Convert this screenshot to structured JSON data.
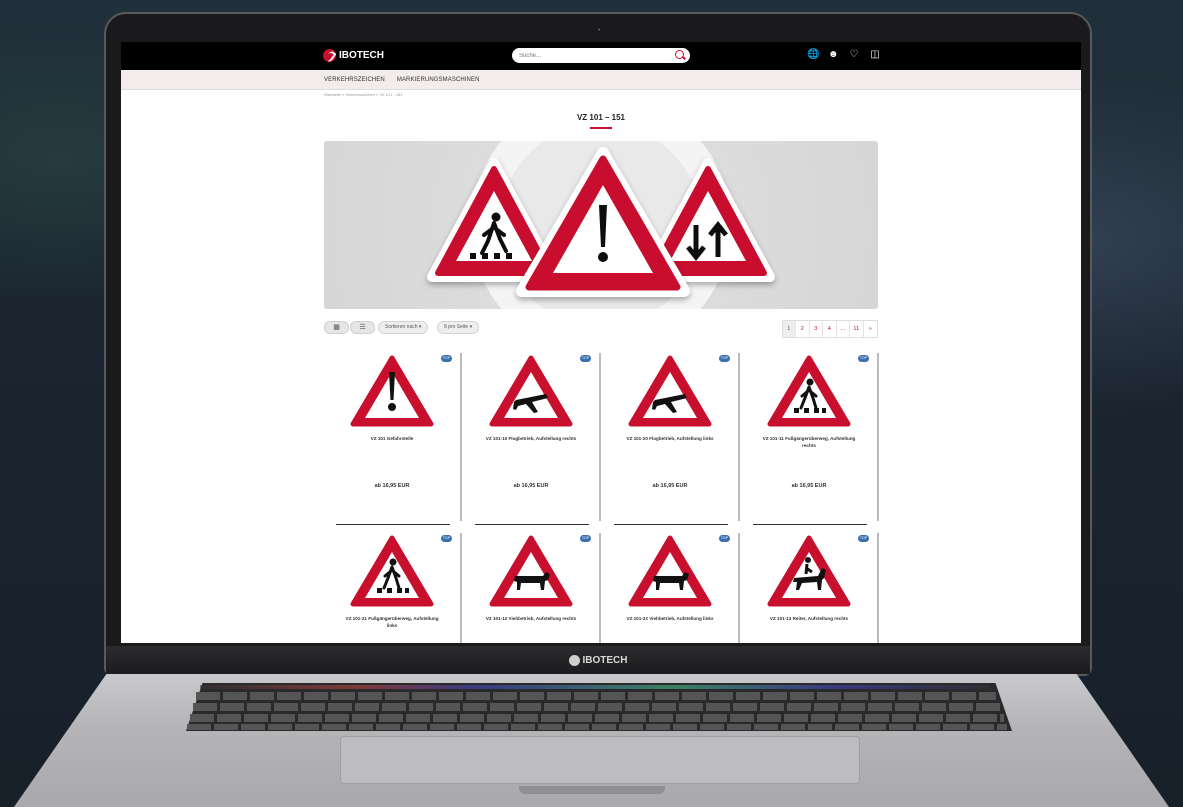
{
  "site": {
    "brand": "IBOTECH",
    "search_placeholder": "Suche...",
    "nav": [
      "VERKEHRSZEICHEN",
      "MARKIERUNGSMASCHINEN"
    ],
    "breadcrumb": "Startseite  »  Verkehrszeichen  »  VZ 101 - 151",
    "page_title": "VZ 101 – 151"
  },
  "toolbar": {
    "sort_label": "Sortieren nach",
    "per_page_label": "8 pro Seite",
    "pages": [
      "1",
      "2",
      "3",
      "4",
      "...",
      "11",
      "»"
    ],
    "current_page": "1"
  },
  "products": [
    {
      "name": "VZ 101 Gefahrstelle",
      "price": "ab 16,95 EUR",
      "symbol": "exclamation-mark"
    },
    {
      "name": "VZ 101-10 Flugbetrieb, Aufstellung rechts",
      "price": "ab 16,95 EUR",
      "symbol": "airplane"
    },
    {
      "name": "VZ 101-20 Flugbetrieb, Aufstellung links",
      "price": "ab 16,95 EUR",
      "symbol": "airplane"
    },
    {
      "name": "VZ 101-11 Fußgängerüberweg, Aufstellung rechts",
      "price": "ab 16,95 EUR",
      "symbol": "pedestrian"
    },
    {
      "name": "VZ 101-21 Fußgängerüberweg, Aufstellung links",
      "symbol": "pedestrian"
    },
    {
      "name": "VZ 101-12 Viehbetrieb, Aufstellung rechts",
      "symbol": "cow"
    },
    {
      "name": "VZ 101-22 Viehbetrieb, Aufstellung links",
      "symbol": "cow"
    },
    {
      "name": "VZ 101-13 Reiter, Aufstellung rechts",
      "symbol": "horse-rider"
    }
  ],
  "badge_text": "TOP",
  "chin_brand": "IBOTECH",
  "colors": {
    "accent": "#c8102e",
    "badge": "#3a6fb0",
    "topbar": "#000000",
    "navbar": "#f2ecec"
  }
}
